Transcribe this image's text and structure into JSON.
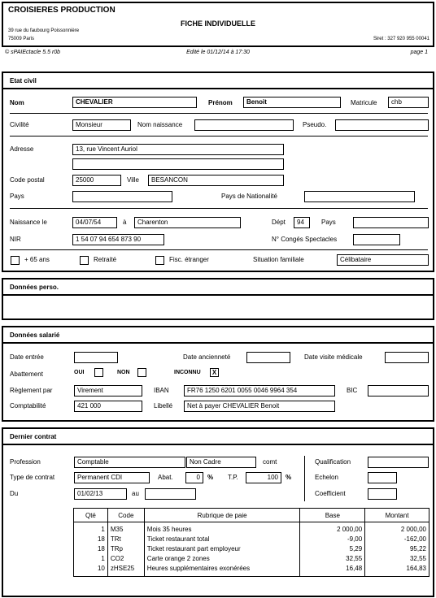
{
  "header": {
    "company": "CROISIERES PRODUCTION",
    "title": "FICHE INDIVIDUELLE",
    "address_line1": "39 rue du faubourg Poissonnière",
    "address_line2": "75009 Paris",
    "siret": "Siret : 327 920 955 00041"
  },
  "footer_bar": {
    "software": "© sPAIEctacle 5.5 r0b",
    "edited": "Edité le 01/12/14 à 17:30",
    "page": "page 1"
  },
  "etat_civil": {
    "title": "Etat civil",
    "nom_label": "Nom",
    "nom": "CHEVALIER",
    "prenom_label": "Prénom",
    "prenom": "Benoit",
    "matricule_label": "Matricule",
    "matricule": "chb",
    "civilite_label": "Civilité",
    "civilite": "Monsieur",
    "nom_naissance_label": "Nom naissance",
    "nom_naissance": "",
    "pseudo_label": "Pseudo.",
    "pseudo": "",
    "adresse_label": "Adresse",
    "adresse1": "13, rue Vincent Auriol",
    "adresse2": "",
    "code_postal_label": "Code postal",
    "code_postal": "25000",
    "ville_label": "Ville",
    "ville": "BESANCON",
    "pays_label": "Pays",
    "pays": "",
    "pays_nat_label": "Pays de Nationalité",
    "pays_nat": "",
    "naissance_label": "Naissance le",
    "naissance": "04/07/54",
    "a_label": "à",
    "lieu_naissance": "Charenton",
    "dept_label": "Dépt",
    "dept": "94",
    "pays_naissance_label": "Pays",
    "pays_naissance": "",
    "nir_label": "NIR",
    "nir": "1 54 07 94 654 873 90",
    "conges_label": "N° Congés Spectacles",
    "conges": "",
    "plus65_label": "+ 65 ans",
    "plus65": "",
    "retraite_label": "Retraité",
    "retraite": "",
    "fisc_label": "Fisc. étranger",
    "fisc": "",
    "situation_label": "Situation familiale",
    "situation": "Célibataire"
  },
  "donnees_perso": {
    "title": "Données perso."
  },
  "donnees_salarie": {
    "title": "Données salarié",
    "date_entree_label": "Date entrée",
    "date_entree": "",
    "date_anciennete_label": "Date ancienneté",
    "date_anciennete": "",
    "date_visite_label": "Date visite médicale",
    "date_visite": "",
    "abattement_label": "Abattement",
    "oui_label": "OUI",
    "oui": "",
    "non_label": "NON",
    "non": "",
    "inconnu_label": "INCONNU",
    "inconnu": "X",
    "reglement_label": "Règlement par",
    "reglement": "Virement",
    "iban_label": "IBAN",
    "iban": "FR76 1250 6201 0055 0046 9964 354",
    "bic_label": "BIC",
    "bic": "",
    "comptabilite_label": "Comptabilité",
    "comptabilite": "421 000",
    "libelle_label": "Libellé",
    "libelle": "Net à payer CHEVALIER Benoit"
  },
  "dernier_contrat": {
    "title": "Dernier contrat",
    "profession_label": "Profession",
    "profession": "Comptable",
    "statut": "Non Cadre",
    "comt_label": "comt",
    "type_label": "Type de contrat",
    "type": "Permanent CDI",
    "abat_label": "Abat.",
    "abat": "0",
    "pct1": "%",
    "tp_label": "T.P.",
    "tp": "100",
    "pct2": "%",
    "du_label": "Du",
    "du": "01/02/13",
    "au_label": "au",
    "au": "",
    "qualification_label": "Qualification",
    "qualification": "",
    "echelon_label": "Echelon",
    "echelon": "",
    "coefficient_label": "Coefficient",
    "coefficient": "",
    "table": {
      "headers": [
        "Qté",
        "Code",
        "Rubrique de paie",
        "Base",
        "Montant"
      ],
      "rows": [
        [
          "1",
          "M35",
          "Mois 35 heures",
          "2 000,00",
          "2 000,00"
        ],
        [
          "18",
          "TRt",
          "Ticket restaurant total",
          "-9,00",
          "-162,00"
        ],
        [
          "18",
          "TRp",
          "Ticket restaurant part employeur",
          "5,29",
          "95,22"
        ],
        [
          "1",
          "CO2",
          "Carte orange 2 zones",
          "32,55",
          "32,55"
        ],
        [
          "10",
          "zHSE25",
          "Heures supplémentaires exonérées",
          "16,48",
          "164,83"
        ]
      ]
    }
  }
}
